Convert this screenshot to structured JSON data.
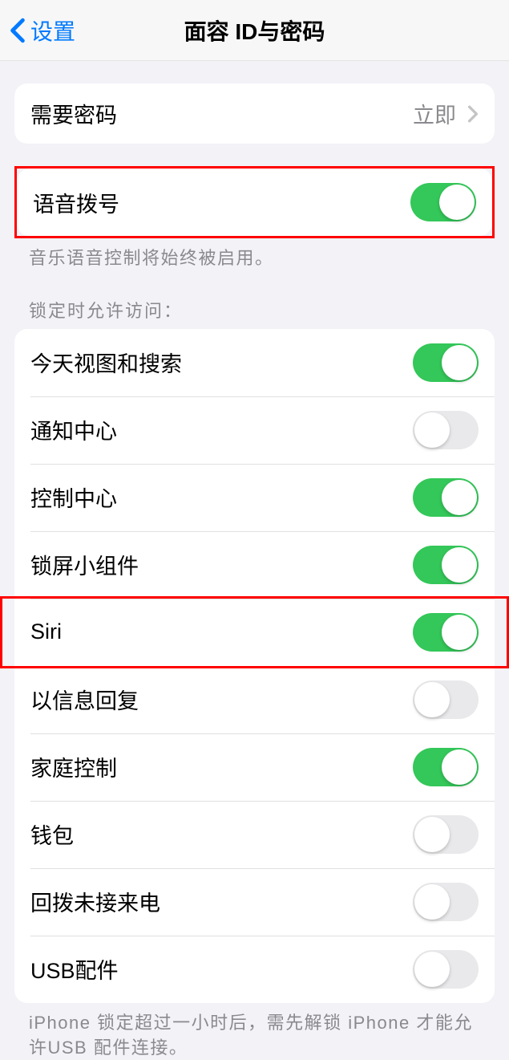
{
  "header": {
    "back_label": "设置",
    "title": "面容 ID与密码"
  },
  "require_passcode": {
    "label": "需要密码",
    "value": "立即"
  },
  "voice_dial": {
    "label": "语音拨号",
    "on": true,
    "footer": "音乐语音控制将始终被启用。"
  },
  "lock_access": {
    "header": "锁定时允许访问：",
    "items": [
      {
        "label": "今天视图和搜索",
        "on": true
      },
      {
        "label": "通知中心",
        "on": false
      },
      {
        "label": "控制中心",
        "on": true
      },
      {
        "label": "锁屏小组件",
        "on": true
      },
      {
        "label": "Siri",
        "on": true
      },
      {
        "label": "以信息回复",
        "on": false
      },
      {
        "label": "家庭控制",
        "on": true
      },
      {
        "label": "钱包",
        "on": false
      },
      {
        "label": "回拨未接来电",
        "on": false
      },
      {
        "label": "USB配件",
        "on": false
      }
    ],
    "footer": "iPhone 锁定超过一小时后，需先解锁 iPhone 才能允许USB 配件连接。"
  }
}
